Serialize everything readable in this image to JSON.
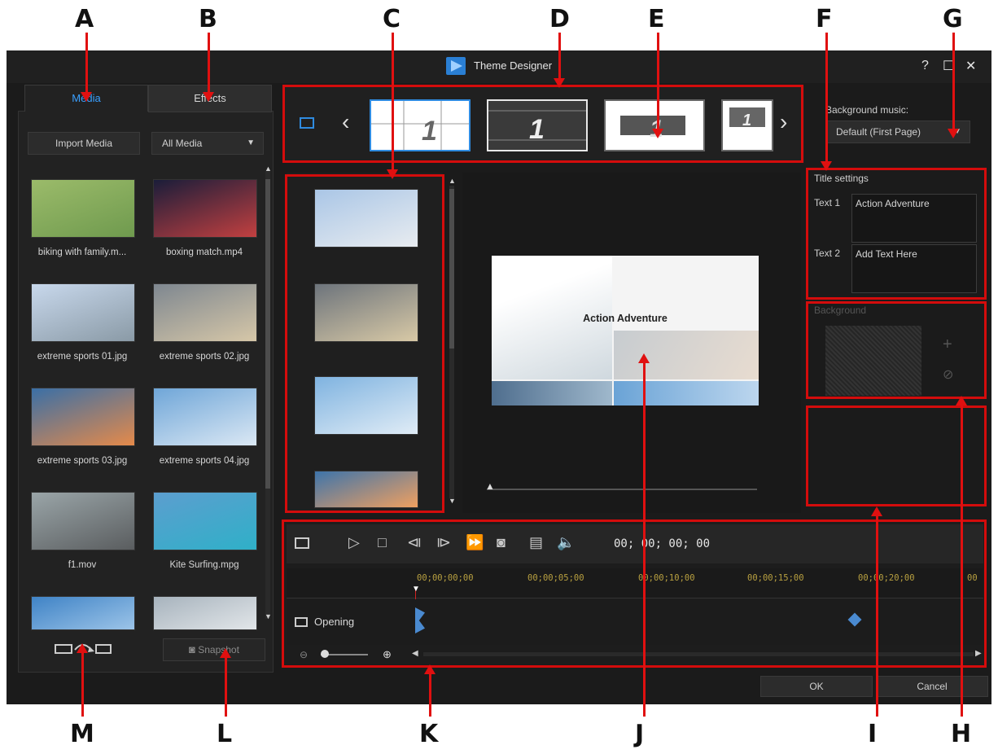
{
  "callouts": [
    "A",
    "B",
    "C",
    "D",
    "E",
    "F",
    "G",
    "H",
    "I",
    "J",
    "K",
    "L",
    "M"
  ],
  "window": {
    "title": "Theme Designer",
    "help": "?",
    "maximize": "☐",
    "close": "✕"
  },
  "tabs": {
    "media": "Media",
    "effects": "Effects"
  },
  "media_panel": {
    "import_button": "Import Media",
    "filter_value": "All Media",
    "items": [
      {
        "name": "biking with family.m...",
        "colors": [
          "#9bbb6a",
          "#6f9a4e"
        ]
      },
      {
        "name": "boxing match.mp4",
        "colors": [
          "#1a1d3a",
          "#c24040"
        ]
      },
      {
        "name": "extreme sports 01.jpg",
        "colors": [
          "#c8d8ec",
          "#8a9aa6"
        ]
      },
      {
        "name": "extreme sports 02.jpg",
        "colors": [
          "#7e8790",
          "#d6c7a8"
        ]
      },
      {
        "name": "extreme sports 03.jpg",
        "colors": [
          "#3a6fa6",
          "#e58a4a"
        ]
      },
      {
        "name": "extreme sports 04.jpg",
        "colors": [
          "#6fa6d8",
          "#dbe8f4"
        ]
      },
      {
        "name": "f1.mov",
        "colors": [
          "#9aa5a8",
          "#5a5d5f"
        ]
      },
      {
        "name": "Kite Surfing.mpg",
        "colors": [
          "#5c9ecf",
          "#2fb0c8"
        ]
      },
      {
        "name": "",
        "colors": [
          "#3f83c6",
          "#9cc4e8"
        ]
      },
      {
        "name": "",
        "colors": [
          "#a7b3bd",
          "#e2e6e9"
        ]
      }
    ],
    "snapshot_button": "Snapshot"
  },
  "slot_thumbnails": [
    {
      "colors": [
        "#aac6e6",
        "#e8ecf0"
      ]
    },
    {
      "colors": [
        "#6d747c",
        "#d8c9a6"
      ]
    },
    {
      "colors": [
        "#7fb3e0",
        "#e0ecf6"
      ]
    },
    {
      "colors": [
        "#3e74aa",
        "#f0a060"
      ]
    }
  ],
  "templates": [
    "1",
    "1",
    "1",
    "1"
  ],
  "preview": {
    "title": "Action Adventure"
  },
  "background_music": {
    "label": "Background music:",
    "value": "Default (First Page)"
  },
  "title_settings": {
    "heading": "Title settings",
    "text1_label": "Text 1",
    "text1_value": "Action Adventure",
    "text2_label": "Text 2",
    "text2_value": "Add Text Here"
  },
  "background": {
    "heading": "Background",
    "add": "+",
    "remove": "⊘"
  },
  "timeline": {
    "timecode": "00; 00; 00; 00",
    "ruler": [
      "00;00;00;00",
      "00;00;05;00",
      "00;00;10;00",
      "00;00;15;00",
      "00;00;20;00",
      "00"
    ],
    "track_label": "Opening"
  },
  "buttons": {
    "ok": "OK",
    "cancel": "Cancel"
  },
  "accent": "#d40c0c"
}
